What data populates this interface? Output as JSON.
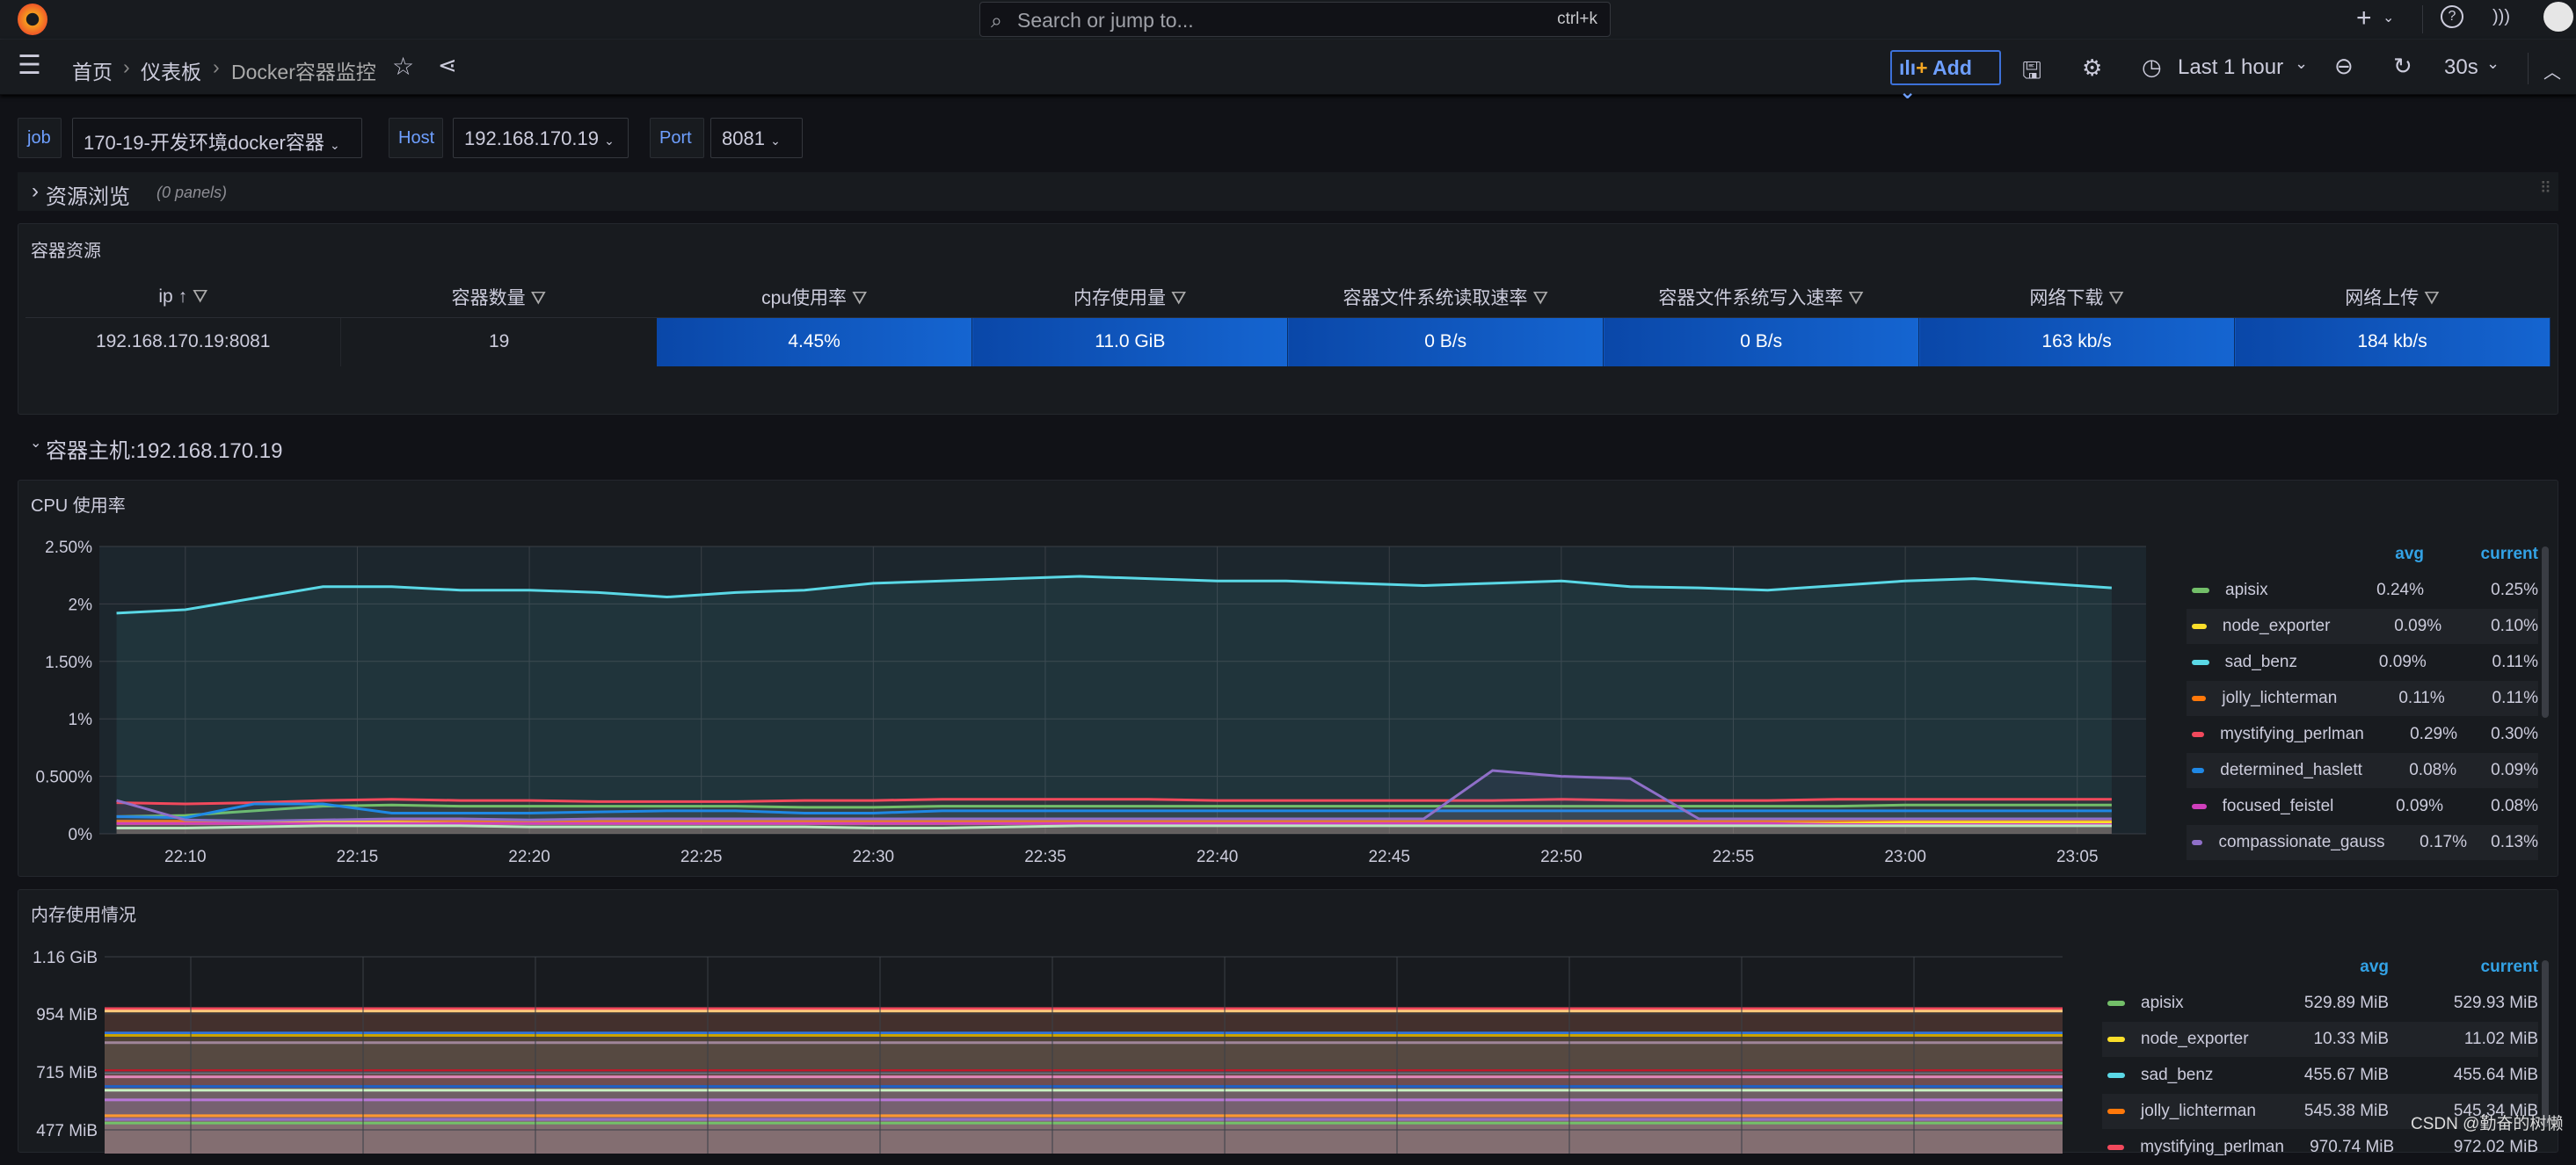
{
  "topbar": {
    "search_placeholder": "Search or jump to...",
    "search_shortcut": "ctrl+k",
    "new_label": "+",
    "icons": [
      "grafana-logo-icon",
      "search-icon",
      "plus-icon",
      "help-icon",
      "news-icon",
      "avatar-icon"
    ]
  },
  "nav": {
    "breadcrumb": [
      "首页",
      "仪表板",
      "Docker容器监控"
    ],
    "add_label": "Add",
    "time_range": "Last 1 hour",
    "refresh_interval": "30s"
  },
  "variables": [
    {
      "label": "job",
      "value": "170-19-开发环境docker容器"
    },
    {
      "label": "Host",
      "value": "192.168.170.19"
    },
    {
      "label": "Port",
      "value": "8081"
    }
  ],
  "rows": {
    "browse": {
      "title": "资源浏览",
      "note": "(0 panels)"
    },
    "host": {
      "title": "容器主机:192.168.170.19"
    }
  },
  "table_panel": {
    "title": "容器资源",
    "headers": [
      "ip",
      "容器数量",
      "cpu使用率",
      "内存使用量",
      "容器文件系统读取速率",
      "容器文件系统写入速率",
      "网络下载",
      "网络上传"
    ],
    "sort_indicator": "↑",
    "rows": [
      [
        "192.168.170.19:8081",
        "19",
        "4.45%",
        "11.0 GiB",
        "0 B/s",
        "0 B/s",
        "163 kb/s",
        "184 kb/s"
      ]
    ],
    "cell_color": "#0a52c0"
  },
  "cpu_panel": {
    "title": "CPU 使用率",
    "legend": {
      "headers": [
        "avg",
        "current"
      ],
      "items": [
        {
          "name": "apisix",
          "color": "#73bf69",
          "avg": "0.24%",
          "current": "0.25%"
        },
        {
          "name": "node_exporter",
          "color": "#fade2a",
          "avg": "0.09%",
          "current": "0.10%"
        },
        {
          "name": "sad_benz",
          "color": "#5ad8e6",
          "avg": "0.09%",
          "current": "0.11%"
        },
        {
          "name": "jolly_lichterman",
          "color": "#ff780a",
          "avg": "0.11%",
          "current": "0.11%"
        },
        {
          "name": "mystifying_perlman",
          "color": "#f2495c",
          "avg": "0.29%",
          "current": "0.30%"
        },
        {
          "name": "determined_haslett",
          "color": "#1f88e5",
          "avg": "0.08%",
          "current": "0.09%"
        },
        {
          "name": "focused_feistel",
          "color": "#d03fbc",
          "avg": "0.09%",
          "current": "0.08%"
        },
        {
          "name": "compassionate_gauss",
          "color": "#8f6fc8",
          "avg": "0.17%",
          "current": "0.13%"
        }
      ]
    }
  },
  "mem_panel": {
    "title": "内存使用情况",
    "legend": {
      "headers": [
        "avg",
        "current"
      ],
      "items": [
        {
          "name": "apisix",
          "color": "#73bf69",
          "avg": "529.89 MiB",
          "current": "529.93 MiB"
        },
        {
          "name": "node_exporter",
          "color": "#fade2a",
          "avg": "10.33 MiB",
          "current": "11.02 MiB"
        },
        {
          "name": "sad_benz",
          "color": "#5ad8e6",
          "avg": "455.67 MiB",
          "current": "455.64 MiB"
        },
        {
          "name": "jolly_lichterman",
          "color": "#ff780a",
          "avg": "545.38 MiB",
          "current": "545.34 MiB"
        },
        {
          "name": "mystifying_perlman",
          "color": "#f2495c",
          "avg": "970.74 MiB",
          "current": "972.02 MiB"
        }
      ]
    }
  },
  "chart_data": [
    {
      "type": "line",
      "title": "CPU 使用率",
      "xlabel": "",
      "ylabel": "",
      "grid": true,
      "legend": "right",
      "x": [
        "22:08",
        "22:10",
        "22:12",
        "22:14",
        "22:16",
        "22:18",
        "22:20",
        "22:22",
        "22:24",
        "22:26",
        "22:28",
        "22:30",
        "22:32",
        "22:34",
        "22:36",
        "22:38",
        "22:40",
        "22:42",
        "22:44",
        "22:46",
        "22:48",
        "22:50",
        "22:52",
        "22:54",
        "22:56",
        "22:58",
        "23:00",
        "23:02",
        "23:04",
        "23:06"
      ],
      "xticks": [
        "22:10",
        "22:15",
        "22:20",
        "22:25",
        "22:30",
        "22:35",
        "22:40",
        "22:45",
        "22:50",
        "22:55",
        "23:00",
        "23:05"
      ],
      "yticks": [
        "0%",
        "0.500%",
        "1%",
        "1.50%",
        "2%",
        "2.50%"
      ],
      "ylim": [
        0,
        2.5
      ],
      "series": [
        {
          "color": "#5ad8e6",
          "values": [
            1.92,
            1.95,
            2.05,
            2.15,
            2.15,
            2.12,
            2.12,
            2.1,
            2.06,
            2.1,
            2.12,
            2.18,
            2.2,
            2.22,
            2.24,
            2.22,
            2.2,
            2.2,
            2.18,
            2.16,
            2.18,
            2.2,
            2.15,
            2.14,
            2.12,
            2.16,
            2.2,
            2.22,
            2.18,
            2.14
          ]
        },
        {
          "name": "mystifying_perlman",
          "color": "#f2495c",
          "values": [
            0.27,
            0.26,
            0.27,
            0.29,
            0.3,
            0.29,
            0.29,
            0.28,
            0.28,
            0.28,
            0.29,
            0.29,
            0.3,
            0.3,
            0.3,
            0.3,
            0.29,
            0.29,
            0.29,
            0.29,
            0.29,
            0.3,
            0.29,
            0.29,
            0.29,
            0.3,
            0.3,
            0.3,
            0.3,
            0.3
          ]
        },
        {
          "name": "apisix",
          "color": "#73bf69",
          "values": [
            0.15,
            0.16,
            0.2,
            0.24,
            0.25,
            0.24,
            0.24,
            0.24,
            0.24,
            0.24,
            0.23,
            0.23,
            0.24,
            0.24,
            0.24,
            0.24,
            0.24,
            0.24,
            0.24,
            0.24,
            0.24,
            0.24,
            0.24,
            0.24,
            0.24,
            0.24,
            0.25,
            0.25,
            0.25,
            0.25
          ]
        },
        {
          "name": "jolly_lichterman",
          "color": "#ff780a",
          "values": [
            0.11,
            0.11,
            0.11,
            0.11,
            0.11,
            0.11,
            0.11,
            0.11,
            0.11,
            0.11,
            0.11,
            0.11,
            0.11,
            0.11,
            0.11,
            0.11,
            0.11,
            0.11,
            0.11,
            0.11,
            0.11,
            0.11,
            0.11,
            0.11,
            0.11,
            0.11,
            0.11,
            0.11,
            0.11,
            0.11
          ]
        },
        {
          "name": "determined_haslett",
          "color": "#1f88e5",
          "values": [
            0.15,
            0.14,
            0.26,
            0.26,
            0.18,
            0.18,
            0.18,
            0.19,
            0.2,
            0.2,
            0.18,
            0.18,
            0.2,
            0.2,
            0.2,
            0.2,
            0.2,
            0.2,
            0.2,
            0.2,
            0.2,
            0.2,
            0.2,
            0.2,
            0.2,
            0.2,
            0.2,
            0.2,
            0.2,
            0.2
          ]
        },
        {
          "name": "compassionate_gauss",
          "color": "#8f6fc8",
          "values": [
            0.29,
            0.12,
            0.11,
            0.12,
            0.13,
            0.13,
            0.12,
            0.13,
            0.13,
            0.13,
            0.13,
            0.13,
            0.13,
            0.13,
            0.13,
            0.13,
            0.13,
            0.13,
            0.13,
            0.13,
            0.55,
            0.5,
            0.48,
            0.13,
            0.13,
            0.13,
            0.13,
            0.13,
            0.13,
            0.13
          ]
        },
        {
          "name": "node_exporter",
          "color": "#fade2a",
          "values": [
            0.09,
            0.09,
            0.09,
            0.1,
            0.1,
            0.09,
            0.09,
            0.09,
            0.09,
            0.09,
            0.09,
            0.09,
            0.09,
            0.09,
            0.09,
            0.09,
            0.09,
            0.09,
            0.09,
            0.09,
            0.09,
            0.09,
            0.09,
            0.09,
            0.09,
            0.09,
            0.1,
            0.1,
            0.1,
            0.1
          ]
        },
        {
          "name": "focused_feistel",
          "color": "#d03fbc",
          "values": [
            0.09,
            0.09,
            0.09,
            0.09,
            0.09,
            0.09,
            0.09,
            0.09,
            0.09,
            0.09,
            0.09,
            0.09,
            0.09,
            0.09,
            0.09,
            0.09,
            0.09,
            0.09,
            0.09,
            0.09,
            0.09,
            0.09,
            0.09,
            0.09,
            0.09,
            0.08,
            0.08,
            0.08,
            0.08,
            0.08
          ]
        },
        {
          "name": "sad_benz",
          "color": "#b8e6c0",
          "values": [
            0.05,
            0.05,
            0.06,
            0.07,
            0.07,
            0.07,
            0.06,
            0.06,
            0.06,
            0.06,
            0.06,
            0.05,
            0.05,
            0.06,
            0.07,
            0.07,
            0.07,
            0.07,
            0.07,
            0.07,
            0.07,
            0.07,
            0.07,
            0.07,
            0.07,
            0.07,
            0.07,
            0.07,
            0.07,
            0.07
          ]
        }
      ]
    },
    {
      "type": "area",
      "title": "内存使用情况",
      "xlabel": "",
      "ylabel": "",
      "grid": true,
      "legend": "right",
      "yticks": [
        "477 MiB",
        "715 MiB",
        "954 MiB",
        "1.16 GiB"
      ],
      "ylim_mib": [
        460,
        1188
      ],
      "series": [
        {
          "color": "#f2495c",
          "value_mib": 975
        },
        {
          "color": "#ffcb7d",
          "value_mib": 965
        },
        {
          "color": "#3274d9",
          "value_mib": 875
        },
        {
          "color": "#cca300",
          "value_mib": 865
        },
        {
          "color": "#a0859a",
          "value_mib": 835
        },
        {
          "color": "#c4162a",
          "value_mib": 720
        },
        {
          "color": "#6d7080",
          "value_mib": 712
        },
        {
          "color": "#de85b8",
          "value_mib": 695
        },
        {
          "color": "#1f60c4",
          "value_mib": 655
        },
        {
          "color": "#c8f2c2",
          "value_mib": 640
        },
        {
          "color": "#b877d9",
          "value_mib": 600
        },
        {
          "color": "#ff9830",
          "value_mib": 535
        },
        {
          "color": "#8f6fc8",
          "value_mib": 520
        },
        {
          "color": "#73bf69",
          "value_mib": 505
        }
      ]
    }
  ]
}
